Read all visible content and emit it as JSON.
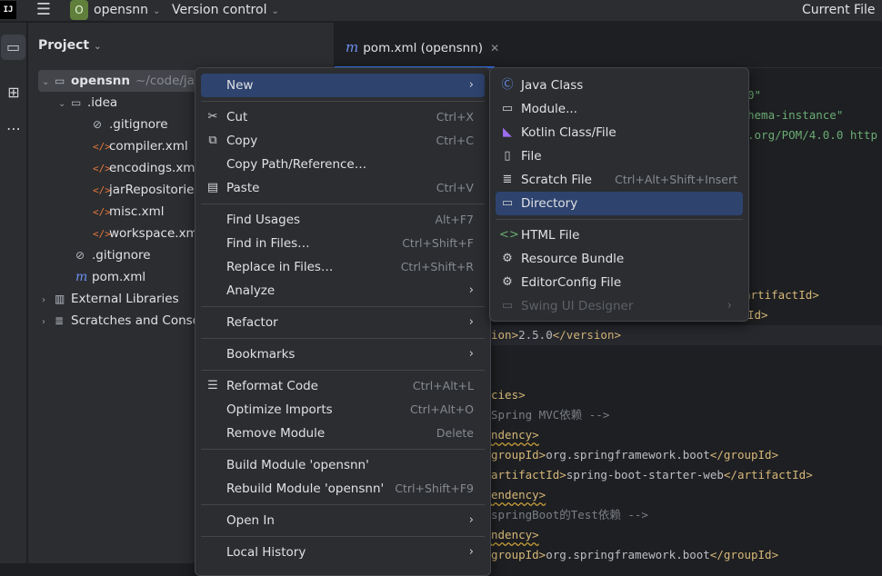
{
  "titlebar": {
    "logo": "IJ",
    "project_badge": "O",
    "project_name": "opensnn",
    "vcs": "Version control",
    "run_config": "Current File"
  },
  "project_panel": {
    "title": "Project",
    "tree": [
      {
        "label": "opensnn",
        "suffix": "~/code/java",
        "icon": "module-folder-icon"
      },
      {
        "label": ".idea",
        "icon": "folder-icon"
      },
      {
        "label": ".gitignore",
        "icon": "ignore-file-icon"
      },
      {
        "label": "compiler.xml",
        "icon": "xml-icon"
      },
      {
        "label": "encodings.xml",
        "icon": "xml-icon"
      },
      {
        "label": "jarRepositories",
        "icon": "xml-icon"
      },
      {
        "label": "misc.xml",
        "icon": "xml-icon"
      },
      {
        "label": "workspace.xml",
        "icon": "xml-icon"
      },
      {
        "label": ".gitignore",
        "icon": "ignore-file-icon"
      },
      {
        "label": "pom.xml",
        "icon": "maven-icon"
      },
      {
        "label": "External Libraries",
        "icon": "library-icon"
      },
      {
        "label": "Scratches and Consol",
        "icon": "scratches-icon"
      }
    ]
  },
  "editor": {
    "tab_label": "pom.xml (opensnn)",
    "code": [
      {
        "pre": "",
        "text": "0\""
      },
      {
        "pre": "",
        "text": "hema-instance\""
      },
      {
        "pre": "",
        "text": ".org/POM/4.0.0 http"
      },
      {
        "pre": "",
        "text": "artifactId>"
      },
      {
        "pre": "",
        "text": "Id>"
      },
      {
        "pre": "ion>",
        "text": "2.5.0",
        "post": "</version>"
      },
      {
        "pre": "",
        "text": "cies>"
      },
      {
        "pre": "",
        "text": "Spring MVC依赖 -->"
      },
      {
        "pre": "",
        "text": "ndency>"
      },
      {
        "pre": "groupId>",
        "text": "org.springframework.boot",
        "post": "</groupId>"
      },
      {
        "pre": "artifactId>",
        "text": "spring-boot-starter-web",
        "post": "</artifactId>"
      },
      {
        "pre": "",
        "text": "endency>"
      },
      {
        "pre": "",
        "text": "springBoot的Test依赖 -->"
      },
      {
        "pre": "",
        "text": "ndency>"
      },
      {
        "pre": "groupId>",
        "text": "org.springframework.boot",
        "post": "</groupId>"
      }
    ]
  },
  "context_menu": {
    "items": [
      {
        "label": "New",
        "submenu": true
      },
      {
        "label": "Cut",
        "shortcut": "Ctrl+X",
        "icon": "scissors-icon"
      },
      {
        "label": "Copy",
        "shortcut": "Ctrl+C",
        "icon": "copy-icon"
      },
      {
        "label": "Copy Path/Reference…"
      },
      {
        "label": "Paste",
        "shortcut": "Ctrl+V",
        "icon": "paste-icon"
      },
      {
        "label": "Find Usages",
        "shortcut": "Alt+F7"
      },
      {
        "label": "Find in Files…",
        "shortcut": "Ctrl+Shift+F"
      },
      {
        "label": "Replace in Files…",
        "shortcut": "Ctrl+Shift+R"
      },
      {
        "label": "Analyze",
        "submenu": true
      },
      {
        "label": "Refactor",
        "submenu": true
      },
      {
        "label": "Bookmarks",
        "submenu": true
      },
      {
        "label": "Reformat Code",
        "shortcut": "Ctrl+Alt+L",
        "icon": "reformat-icon"
      },
      {
        "label": "Optimize Imports",
        "shortcut": "Ctrl+Alt+O"
      },
      {
        "label": "Remove Module",
        "shortcut": "Delete"
      },
      {
        "label": "Build Module 'opensnn'"
      },
      {
        "label": "Rebuild Module 'opensnn'",
        "shortcut": "Ctrl+Shift+F9"
      },
      {
        "label": "Open In",
        "submenu": true
      },
      {
        "label": "Local History",
        "submenu": true
      }
    ]
  },
  "new_submenu": {
    "items": [
      {
        "label": "Java Class",
        "icon": "java-class-icon"
      },
      {
        "label": "Module...",
        "icon": "module-icon"
      },
      {
        "label": "Kotlin Class/File",
        "icon": "kotlin-icon"
      },
      {
        "label": "File",
        "icon": "file-icon"
      },
      {
        "label": "Scratch File",
        "shortcut": "Ctrl+Alt+Shift+Insert",
        "icon": "scratch-file-icon"
      },
      {
        "label": "Directory",
        "icon": "folder-icon",
        "selected": true
      },
      {
        "label": "HTML File",
        "icon": "html-icon"
      },
      {
        "label": "Resource Bundle",
        "icon": "gear-icon"
      },
      {
        "label": "EditorConfig File",
        "icon": "gear-icon"
      },
      {
        "label": "Swing UI Designer",
        "icon": "swing-designer-icon",
        "submenu": true,
        "disabled": true
      }
    ]
  }
}
